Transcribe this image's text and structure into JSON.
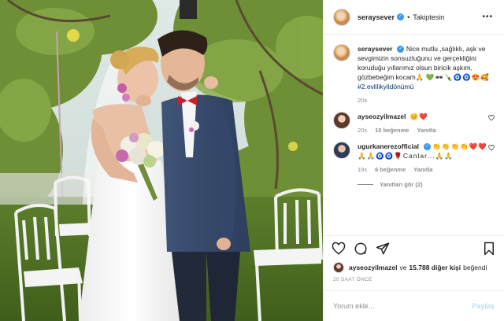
{
  "header": {
    "username": "seraysever",
    "verified_icon": "verified-badge-icon",
    "separator": "•",
    "following_label": "Takiptesin"
  },
  "caption": {
    "username": "seraysever",
    "text": "Nice mutlu ,sağlıklı, aşk ve sevgimizin sonsuzluğunu ve gerçekliğini koruduğu yıllarımız olsun biricik aşkım, gözbebeğim kocam🙏",
    "emojis": "💚🕶🍾🧿🧿😍🥰",
    "hashtag": "#2.evlilikyildönümü",
    "time": "20s"
  },
  "comments": [
    {
      "username": "ayseozyilmazel",
      "text": "😊❤️",
      "time": "20s",
      "likes": "10 beğenme",
      "reply": "Yanıtla"
    },
    {
      "username": "ugurkanerezofficial",
      "text": "👏👏👏👏❤️❤️🙏🙏🧿🧿🌹Canlar...🙏🙏",
      "time": "19s",
      "likes": "6 beğenme",
      "reply": "Yanıtla"
    }
  ],
  "view_replies": "Yanıtları gör (2)",
  "likes": {
    "user": "ayseozyilmazel",
    "connector": "ve",
    "count": "15.788 diğer kişi",
    "suffix": "beğendi"
  },
  "timestamp": "20 SAAT ÖNCE",
  "add_comment": {
    "placeholder": "Yorum ekle...",
    "post_label": "Paylaş"
  },
  "colors": {
    "link": "#00376b",
    "muted": "#8e8e8e",
    "verified": "#3897f0",
    "like_red": "#ed4956",
    "post_disabled": "#b2dffc"
  }
}
